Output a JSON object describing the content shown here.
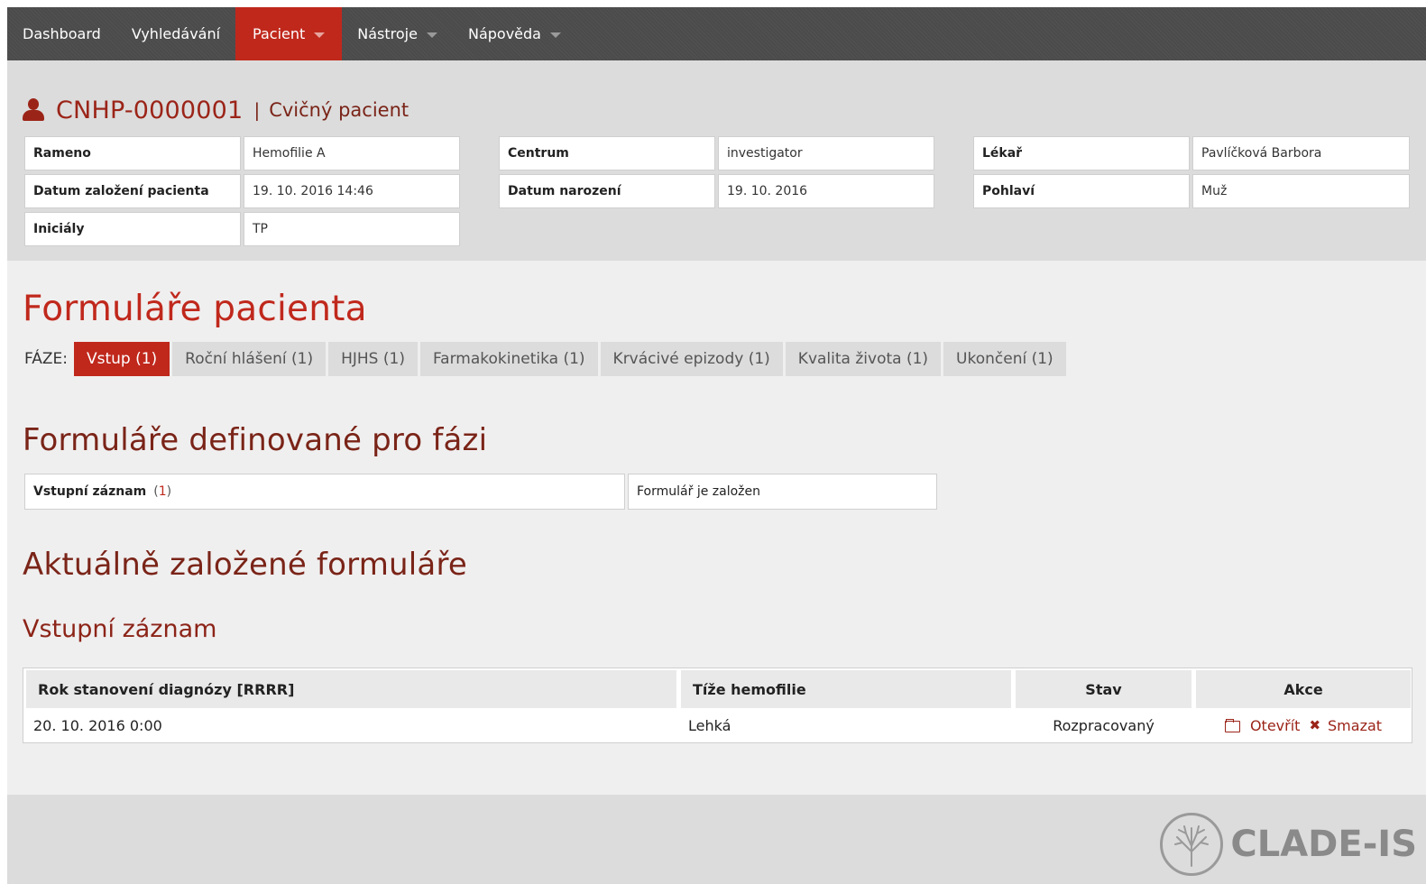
{
  "nav": {
    "items": [
      {
        "label": "Dashboard"
      },
      {
        "label": "Vyhledávání"
      },
      {
        "label": "Pacient"
      },
      {
        "label": "Nástroje"
      },
      {
        "label": "Nápověda"
      }
    ]
  },
  "patient": {
    "id": "CNHP-0000001",
    "separator": "|",
    "name": "Cvičný pacient",
    "fields": {
      "rameno_label": "Rameno",
      "rameno_value": "Hemofilie A",
      "centrum_label": "Centrum",
      "centrum_value": "investigator",
      "lekar_label": "Lékař",
      "lekar_value": "Pavlíčková Barbora",
      "datum_zalozeni_label": "Datum založení pacienta",
      "datum_zalozeni_value": "19. 10. 2016 14:46",
      "datum_narozeni_label": "Datum narození",
      "datum_narozeni_value": "19. 10. 2016",
      "pohlavi_label": "Pohlaví",
      "pohlavi_value": "Muž",
      "inicialy_label": "Iniciály",
      "inicialy_value": "TP"
    }
  },
  "forms": {
    "title": "Formuláře pacienta",
    "phase_label": "FÁZE:",
    "phases": [
      {
        "label": "Vstup (1)"
      },
      {
        "label": "Roční hlášení (1)"
      },
      {
        "label": "HJHS (1)"
      },
      {
        "label": "Farmakokinetika (1)"
      },
      {
        "label": "Krvácivé epizody (1)"
      },
      {
        "label": "Kvalita života (1)"
      },
      {
        "label": "Ukončení (1)"
      }
    ]
  },
  "defined": {
    "title": "Formuláře definované pro fázi",
    "form_name": "Vstupní záznam",
    "count_open": "(",
    "count": "1",
    "count_close": ")",
    "status": "Formulář je založen"
  },
  "current": {
    "title": "Aktuálně založené formuláře",
    "subtitle": "Vstupní záznam",
    "columns": {
      "year": "Rok stanovení diagnózy [RRRR]",
      "severity": "Tíže hemofilie",
      "status": "Stav",
      "actions": "Akce"
    },
    "row": {
      "year": "20. 10. 2016 0:00",
      "severity": "Lehká",
      "status": "Rozpracovaný",
      "open": "Otevřít",
      "delete": "Smazat"
    }
  },
  "footer": {
    "logo_text": "CLADE-IS",
    "logo_icon": "tree-icon"
  },
  "colors": {
    "accent": "#c0281c",
    "dark_red": "#7a2418",
    "navbar": "#4b4b4b",
    "header_bg": "#dcdcdc",
    "page_bg": "#f0efef"
  }
}
